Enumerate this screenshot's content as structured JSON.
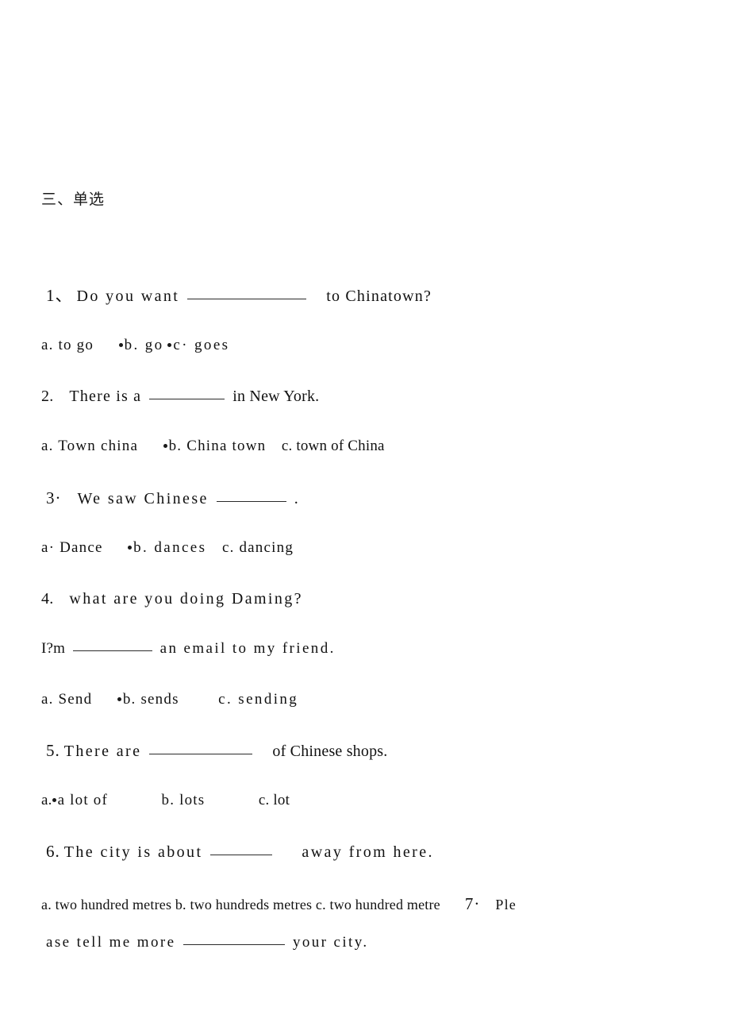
{
  "document": {
    "section_heading": "三、单选",
    "background_color": "#ffffff",
    "text_color": "#111111"
  },
  "questions": [
    {
      "number": "1、",
      "stem_before": "Do you want",
      "stem_after": "to  Chinatown?",
      "options_line": "a. to  go",
      "option_b": "b.  go",
      "option_c": "c·  goes"
    },
    {
      "number": "2.",
      "stem_before": "There is   a",
      "stem_after": "in New York.",
      "option_a": "a. Town china",
      "option_b": "b.  China town",
      "option_c": "c.  town of China"
    },
    {
      "number": "3·",
      "stem_before": "We  saw Chinese",
      "stem_after": ".",
      "option_a": "a·  Dance",
      "option_b": "b. dances",
      "option_c": "c.  dancing"
    },
    {
      "number": "4.",
      "stem": "what are  you doing Daming?",
      "answer_before": "I?m",
      "answer_after": "an  email  to  my friend.",
      "option_a": "a. Send",
      "option_b": "b. sends",
      "option_c": "c. sending"
    },
    {
      "number": "5.",
      "stem_before": "There are",
      "stem_after": "of Chinese  shops.",
      "option_a": "a.",
      "option_a_text": "a lot of",
      "option_b": "b. lots",
      "option_c": "c. lot"
    },
    {
      "number": "6.",
      "stem_before": "The city  is  about",
      "stem_after": "away from here.",
      "options_run": "a. two hundred metres b. two hundreds metres c. two hundred  metre"
    },
    {
      "number": "7·",
      "stem_head": "Ple",
      "stem_tail_before": "ase tell me more",
      "stem_tail_after": "your  city."
    }
  ]
}
